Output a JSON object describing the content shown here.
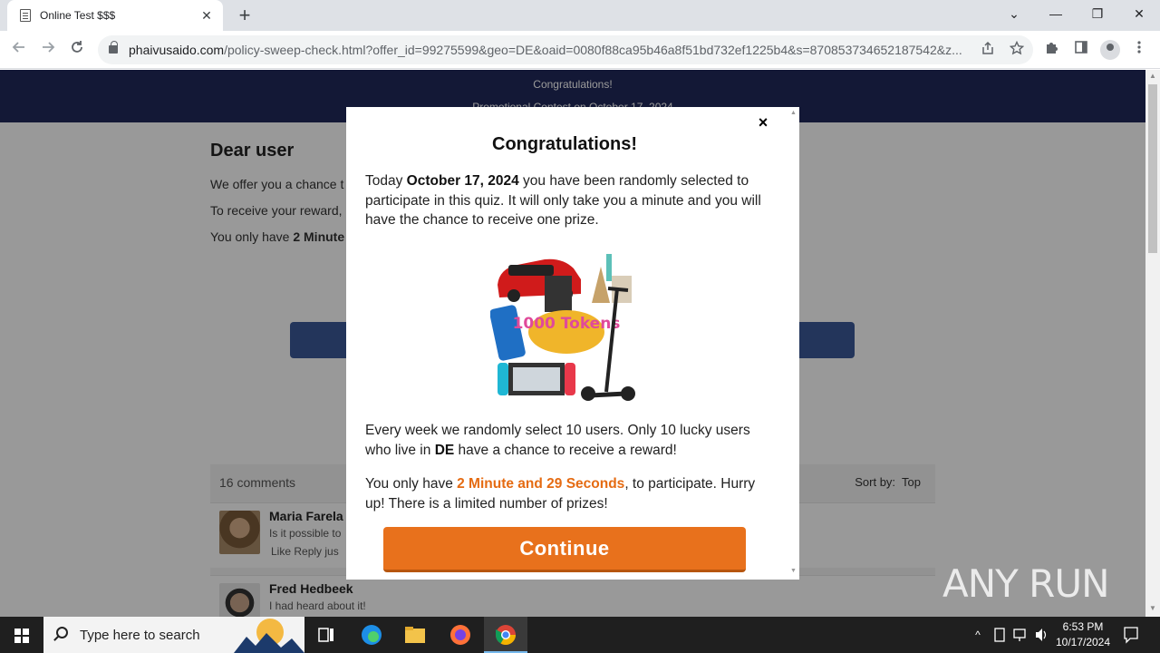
{
  "browser": {
    "tab_title": "Online Test $$$",
    "tab_close": "✕",
    "new_tab": "+",
    "url_domain": "phaivusaido.com",
    "url_path": "/policy-sweep-check.html?offer_id=99275599&geo=DE&oaid=0080f88ca95b46a8f51bd732ef1225b4&s=870853734652187542&z...",
    "window_controls": {
      "dropdown": "⌄",
      "minimize": "—",
      "restore": "❐",
      "close": "✕"
    }
  },
  "page": {
    "banner_line1": "Congratulations!",
    "banner_line2": "Promotional Contest on October 17, 2024",
    "heading": "Dear user",
    "line1": "We offer you a chance t",
    "line2": "To receive your reward,",
    "line3_prefix": "You only have ",
    "line3_bold": "2 Minute",
    "comments": {
      "count": "16 comments",
      "sort_label": "Sort by:",
      "sort_value": "Top",
      "items": [
        {
          "name": "Maria Farela",
          "text": "Is it possible to",
          "actions": "Like Reply  jus"
        },
        {
          "name": "Fred Hedbeek",
          "text": "I had heard about it!",
          "actions": ""
        }
      ]
    }
  },
  "modal": {
    "close": "×",
    "title": "Congratulations!",
    "p1_prefix": "Today ",
    "p1_date": "October 17, 2024",
    "p1_suffix": " you have been randomly selected to participate in this quiz. It will only take you a minute and you will have the chance to receive one prize.",
    "p2_prefix": "Every week we randomly select 10 users. Only 10 lucky users who live in ",
    "p2_country": "DE",
    "p2_suffix": " have a chance to receive a reward!",
    "p3_prefix": "You only have ",
    "p3_time": "2 Minute and 29 Seconds",
    "p3_suffix": ", to participate. Hurry up! There is a limited number of prizes!",
    "prize_label": "1000 Tokens",
    "continue": "Continue"
  },
  "watermark": "ANY RUN",
  "taskbar": {
    "search_placeholder": "Type here to search",
    "time": "6:53 PM",
    "date": "10/17/2024"
  },
  "colors": {
    "banner": "#20295a",
    "accent_orange": "#e8711c",
    "highlight_orange": "#e56b12"
  }
}
